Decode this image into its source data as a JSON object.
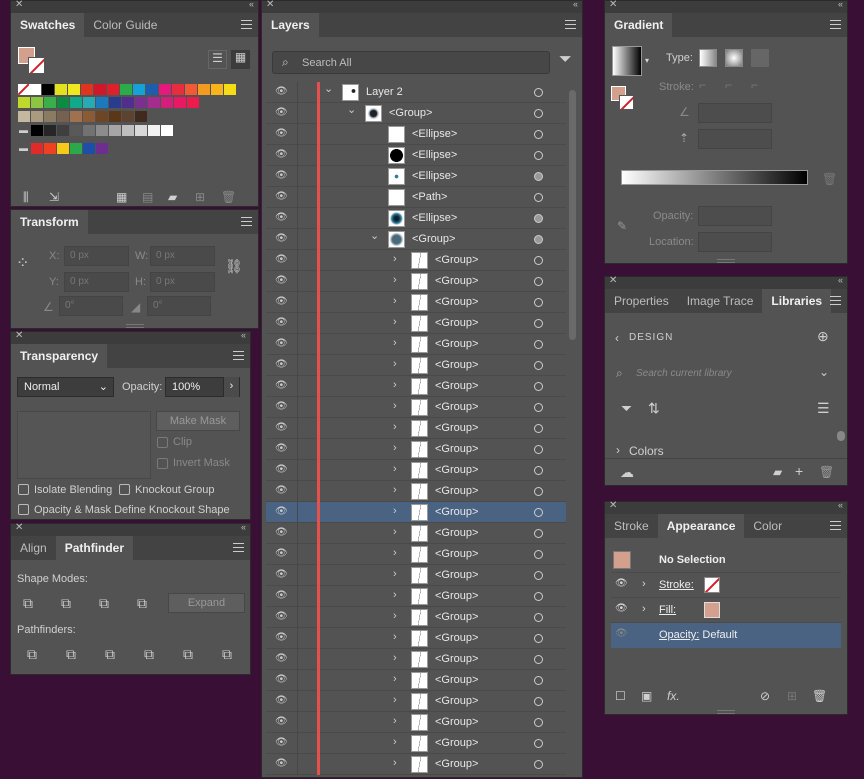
{
  "swatches": {
    "tab1": "Swatches",
    "tab2": "Color Guide",
    "row1": [
      "#ffffff",
      "#000000",
      "#e3e01e",
      "#f0e91f",
      "#e1341e",
      "#d1172b",
      "#df1f29",
      "#2cab4b",
      "#14a2d8",
      "#1d5eac",
      "#e4197b",
      "#e92c3e",
      "#f15a34",
      "#f59a20",
      "#f7b51b",
      "#f6dc17"
    ],
    "row2": [
      "#c0d72b",
      "#8cc540",
      "#3aae48",
      "#0d8b43",
      "#12a98b",
      "#29a9b1",
      "#1d79be",
      "#2b3b90",
      "#522e8c",
      "#7b2f8e",
      "#a42c8f",
      "#d31f7b",
      "#ea1762",
      "#eb1c4c"
    ],
    "row3": [
      "#c4b8a0",
      "#a99a80",
      "#8b7b62",
      "#766150",
      "#a07150",
      "#8a5b34",
      "#6d4625",
      "#5a3716",
      "#5c4231",
      "#3f2a1d"
    ],
    "row4": [
      "#000000",
      "#262626",
      "#3f3f3f",
      "#595959",
      "#727272",
      "#8c8c8c",
      "#a6a6a6",
      "#bfbfbf",
      "#d9d9d9",
      "#f2f2f2",
      "#ffffff"
    ],
    "row5": [
      "#e12b2a",
      "#ef4022",
      "#f6ca18",
      "#2ba84a",
      "#1d4faa",
      "#6d2e8f"
    ]
  },
  "transform": {
    "title": "Transform",
    "x_label": "X:",
    "x_value": "0 px",
    "y_label": "Y:",
    "y_value": "0 px",
    "w_label": "W:",
    "w_value": "0 px",
    "h_label": "H:",
    "h_value": "0 px",
    "angle": "0°",
    "shear": "0°"
  },
  "transparency": {
    "title": "Transparency",
    "blend_mode": "Normal",
    "opacity_label": "Opacity:",
    "opacity_value": "100%",
    "make_mask": "Make Mask",
    "clip": "Clip",
    "invert_mask": "Invert Mask",
    "isolate": "Isolate Blending",
    "knockout": "Knockout Group",
    "opacity_mask": "Opacity & Mask Define Knockout Shape"
  },
  "pathfinder": {
    "tab1": "Align",
    "tab2": "Pathfinder",
    "shape_modes": "Shape Modes:",
    "expand": "Expand",
    "pathfinders": "Pathfinders:"
  },
  "layers": {
    "title": "Layers",
    "search_placeholder": "Search All",
    "rows": [
      {
        "name": "Layer 2",
        "indent": 0,
        "arrow": "down",
        "thumb": "layer",
        "target": "empty"
      },
      {
        "name": "<Group>",
        "indent": 1,
        "arrow": "down",
        "thumb": "eye",
        "target": "empty"
      },
      {
        "name": "<Ellipse>",
        "indent": 2,
        "arrow": "",
        "thumb": "white",
        "target": "empty"
      },
      {
        "name": "<Ellipse>",
        "indent": 2,
        "arrow": "",
        "thumb": "black",
        "target": "empty"
      },
      {
        "name": "<Ellipse>",
        "indent": 2,
        "arrow": "",
        "thumb": "dot",
        "target": "filled"
      },
      {
        "name": "<Path>",
        "indent": 2,
        "arrow": "",
        "thumb": "white",
        "target": "empty"
      },
      {
        "name": "<Ellipse>",
        "indent": 2,
        "arrow": "",
        "thumb": "iris",
        "target": "filled"
      },
      {
        "name": "<Group>",
        "indent": 2,
        "arrow": "down",
        "thumb": "burst",
        "target": "filled"
      },
      {
        "name": "<Group>",
        "indent": 3,
        "arrow": "right",
        "thumb": "line",
        "target": "empty"
      },
      {
        "name": "<Group>",
        "indent": 3,
        "arrow": "right",
        "thumb": "line",
        "target": "empty"
      },
      {
        "name": "<Group>",
        "indent": 3,
        "arrow": "right",
        "thumb": "line",
        "target": "empty"
      },
      {
        "name": "<Group>",
        "indent": 3,
        "arrow": "right",
        "thumb": "line",
        "target": "empty"
      },
      {
        "name": "<Group>",
        "indent": 3,
        "arrow": "right",
        "thumb": "line",
        "target": "empty"
      },
      {
        "name": "<Group>",
        "indent": 3,
        "arrow": "right",
        "thumb": "line",
        "target": "empty"
      },
      {
        "name": "<Group>",
        "indent": 3,
        "arrow": "right",
        "thumb": "line",
        "target": "empty"
      },
      {
        "name": "<Group>",
        "indent": 3,
        "arrow": "right",
        "thumb": "line",
        "target": "empty"
      },
      {
        "name": "<Group>",
        "indent": 3,
        "arrow": "right",
        "thumb": "line",
        "target": "empty"
      },
      {
        "name": "<Group>",
        "indent": 3,
        "arrow": "right",
        "thumb": "line",
        "target": "empty"
      },
      {
        "name": "<Group>",
        "indent": 3,
        "arrow": "right",
        "thumb": "line",
        "target": "empty"
      },
      {
        "name": "<Group>",
        "indent": 3,
        "arrow": "right",
        "thumb": "line",
        "target": "empty"
      },
      {
        "name": "<Group>",
        "indent": 3,
        "arrow": "right",
        "thumb": "line",
        "target": "empty",
        "selected": true
      },
      {
        "name": "<Group>",
        "indent": 3,
        "arrow": "right",
        "thumb": "line",
        "target": "empty"
      },
      {
        "name": "<Group>",
        "indent": 3,
        "arrow": "right",
        "thumb": "line",
        "target": "empty"
      },
      {
        "name": "<Group>",
        "indent": 3,
        "arrow": "right",
        "thumb": "line",
        "target": "empty"
      },
      {
        "name": "<Group>",
        "indent": 3,
        "arrow": "right",
        "thumb": "line",
        "target": "empty"
      },
      {
        "name": "<Group>",
        "indent": 3,
        "arrow": "right",
        "thumb": "line",
        "target": "empty"
      },
      {
        "name": "<Group>",
        "indent": 3,
        "arrow": "right",
        "thumb": "line",
        "target": "empty"
      },
      {
        "name": "<Group>",
        "indent": 3,
        "arrow": "right",
        "thumb": "line",
        "target": "empty"
      },
      {
        "name": "<Group>",
        "indent": 3,
        "arrow": "right",
        "thumb": "line",
        "target": "empty"
      },
      {
        "name": "<Group>",
        "indent": 3,
        "arrow": "right",
        "thumb": "line",
        "target": "empty"
      },
      {
        "name": "<Group>",
        "indent": 3,
        "arrow": "right",
        "thumb": "line",
        "target": "empty"
      },
      {
        "name": "<Group>",
        "indent": 3,
        "arrow": "right",
        "thumb": "line",
        "target": "empty"
      },
      {
        "name": "<Group>",
        "indent": 3,
        "arrow": "right",
        "thumb": "line",
        "target": "empty"
      }
    ]
  },
  "gradient": {
    "title": "Gradient",
    "type_label": "Type:",
    "stroke_label": "Stroke:",
    "opacity_label": "Opacity:",
    "location_label": "Location:"
  },
  "libraries": {
    "tab1": "Properties",
    "tab2": "Image Trace",
    "tab3": "Libraries",
    "library_name": "DESIGN",
    "search_placeholder": "Search current library",
    "colors_section": "Colors"
  },
  "appearance": {
    "tab1": "Stroke",
    "tab2": "Appearance",
    "tab3": "Color",
    "selection": "No Selection",
    "stroke_label": "Stroke:",
    "fill_label": "Fill:",
    "opacity_label": "Opacity:",
    "opacity_value": "Default",
    "fill_color": "#d4a08e",
    "fx": "fx."
  }
}
